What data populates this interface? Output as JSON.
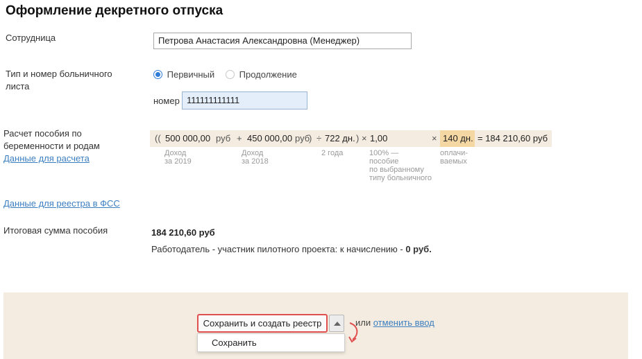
{
  "page_title": "Оформление декретного отпуска",
  "employee": {
    "label": "Сотрудница",
    "value": "Петрова Анастасия Александровна (Менеджер)"
  },
  "sick_leave": {
    "label_line1": "Тип и номер больничного",
    "label_line2": "листа",
    "options": [
      {
        "label": "Первичный",
        "selected": true
      },
      {
        "label": "Продолжение",
        "selected": false
      }
    ],
    "number_label": "номер",
    "number_value": "111111111111"
  },
  "calculation": {
    "label_line1": "Расчет пособия по",
    "label_line2": "беременности и родам",
    "link": "Данные для расчета",
    "open_paren": "((",
    "income_2019": "500 000,00",
    "currency1": "руб",
    "plus": "+",
    "income_2018": "450 000,00",
    "currency2": "руб",
    "close_paren": ")",
    "divide": "÷",
    "days_total": "722 дн.",
    "close_paren2": ")",
    "times1": "×",
    "coefficient": "1,00",
    "times2": "×",
    "paid_days": "140 дн.",
    "result": "= 184 210,60 руб",
    "hints": {
      "income_2019": [
        "Доход",
        "за 2019"
      ],
      "income_2018": [
        "Доход",
        "за 2018"
      ],
      "days_total": [
        "2 года"
      ],
      "coefficient": [
        "100% —",
        "пособие",
        "по выбранному",
        "типу больничного"
      ],
      "paid_days": [
        "оплачи-",
        "ваемых"
      ]
    }
  },
  "fss_link": "Данные для реестра в ФСС",
  "total": {
    "label": "Итоговая сумма пособия",
    "amount": "184 210,60 руб",
    "note_prefix": "Работодатель - участник пилотного проекта: к начислению - ",
    "note_amount": "0 руб."
  },
  "footer": {
    "save_and_create": "Сохранить и создать реестр",
    "or": "или",
    "cancel": "отменить ввод",
    "dropdown_item": "Сохранить"
  },
  "colors": {
    "accent_link": "#3c7fc1",
    "highlight_border": "#e04e4e",
    "formula_bg": "#f4ece0",
    "days_highlight": "#f5d7a4"
  }
}
